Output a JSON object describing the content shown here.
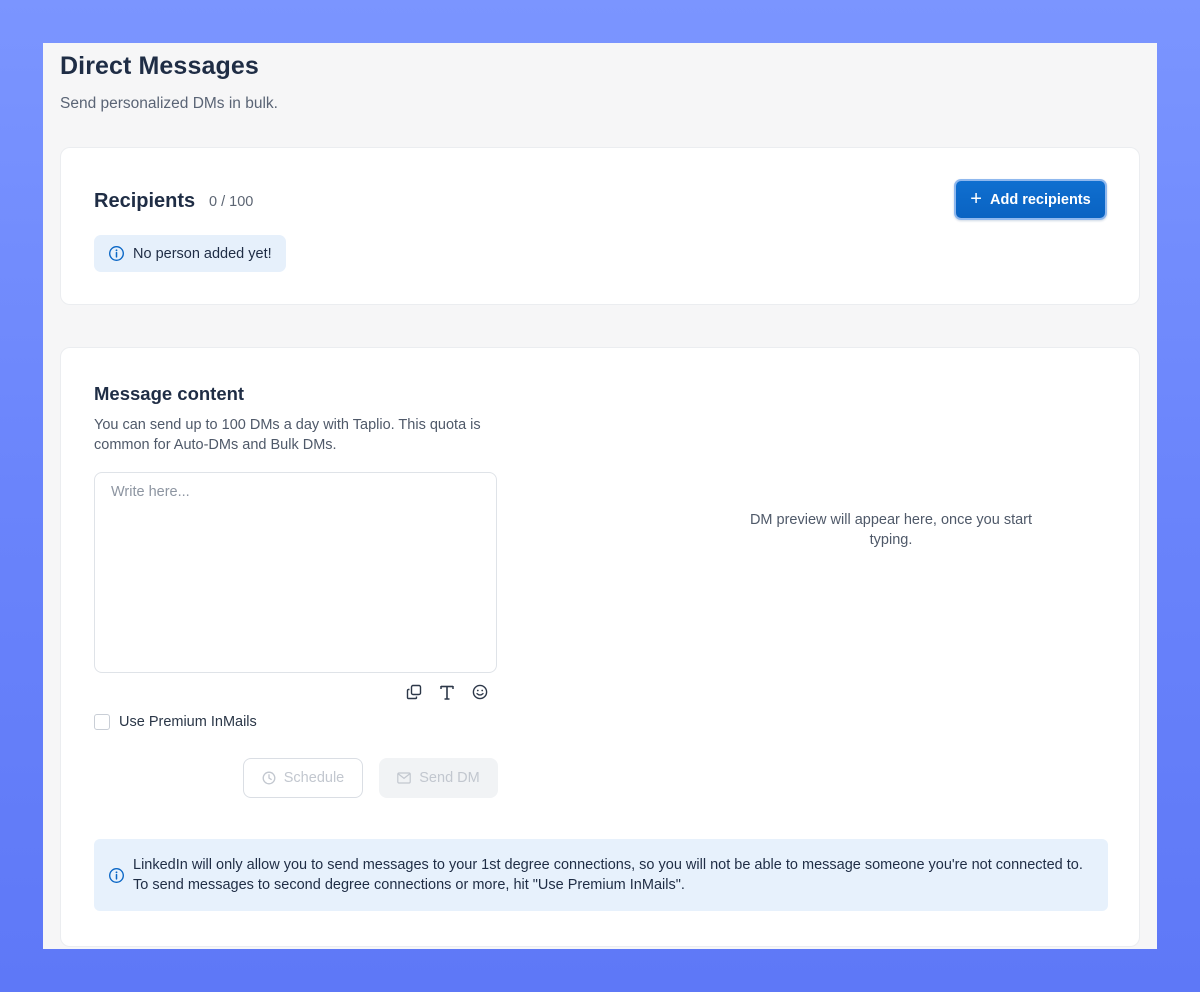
{
  "page": {
    "title": "Direct Messages",
    "subtitle": "Send personalized DMs in bulk."
  },
  "recipients": {
    "title": "Recipients",
    "count": "0 / 100",
    "add_button_label": "Add recipients",
    "empty_message": "No person added yet!"
  },
  "message": {
    "title": "Message content",
    "description": "You can send up to 100 DMs a day with Taplio. This quota is common for Auto-DMs and Bulk DMs.",
    "input_value": "",
    "input_placeholder": "Write here...",
    "toolbar_icons": [
      "copy-icon",
      "text-format-icon",
      "emoji-icon"
    ],
    "premium_inmails_label": "Use Premium InMails",
    "premium_inmails_checked": false,
    "schedule_label": "Schedule",
    "send_label": "Send DM",
    "preview_placeholder": "DM preview will appear here, once you start typing.",
    "notice": "LinkedIn will only allow you to send messages to your 1st degree connections, so you will not be able to message someone you're not connected to. To send messages to second degree connections or more, hit \"Use Premium InMails\"."
  },
  "colors": {
    "accent": "#0b67c6",
    "info_bg": "#e6f0fb",
    "background_gradient": "#6a84fb"
  }
}
